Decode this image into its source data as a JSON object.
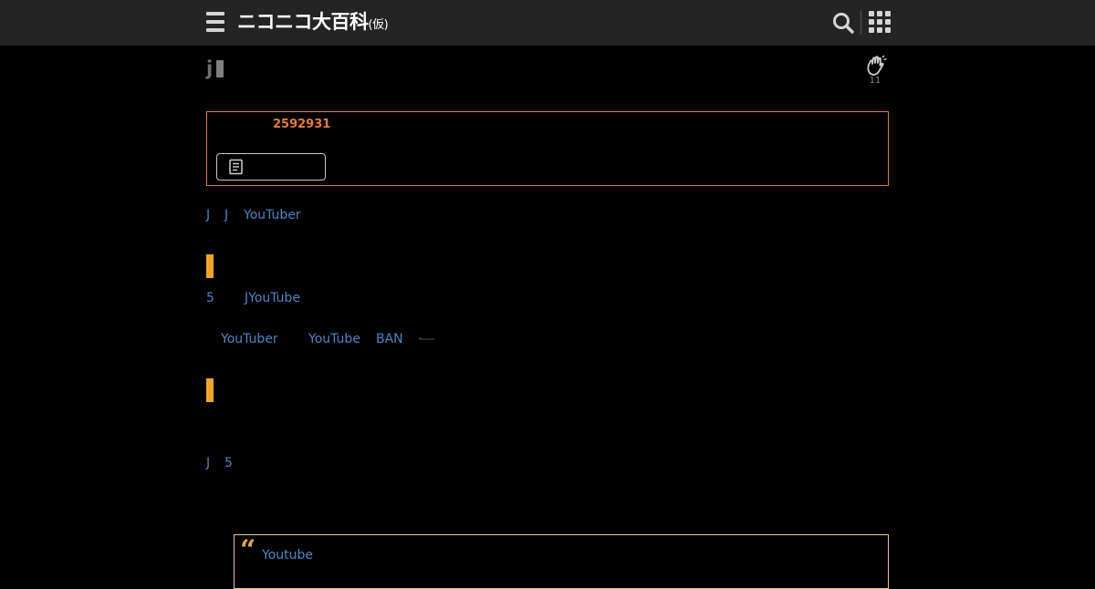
{
  "header": {
    "logo_main": "ニコニコ大百科",
    "logo_sub": "(仮)",
    "menu_icon": "hamburger-menu-icon",
    "search_icon": "search-icon",
    "apps_icon": "apps-grid-icon"
  },
  "article": {
    "title_char": "j",
    "like_count": "11",
    "like_icon": "hand-wave-icon"
  },
  "info": {
    "article_id": "2592931",
    "button_icon": "document-icon"
  },
  "links": {
    "line1_a": "J",
    "line1_b": "J",
    "line1_c": "YouTuber",
    "line2_a": "5",
    "line2_b": "JYouTube",
    "line3_a": "YouTuber",
    "line3_b": "YouTube",
    "line3_c": "BAN",
    "line4_a": "J",
    "line4_b": "5"
  },
  "quote": {
    "link": "Youtube"
  },
  "colors": {
    "background": "#000000",
    "header": "#242424",
    "link": "#4a86c8",
    "accent_orange": "#e47d38",
    "section_bar": "#f3a428",
    "quote_border": "#f3c48a"
  }
}
